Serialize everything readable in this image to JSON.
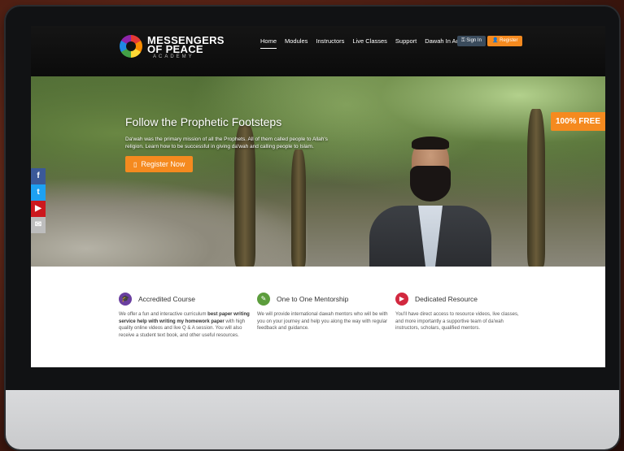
{
  "brand": {
    "line1": "MESSENGERS",
    "line2": "OF PEACE",
    "sub": "ACADEMY"
  },
  "nav": {
    "items": [
      "Home",
      "Modules",
      "Instructors",
      "Live Classes",
      "Support",
      "Dawah In Action"
    ],
    "signin": "Sign In",
    "register": "Register"
  },
  "hero": {
    "title": "Follow the Prophetic Footsteps",
    "text": "Da'wah was the primary mission of all the Prophets. All of them called people to Allah's religion. Learn how to be successful in giving da'wah and calling people to Islam.",
    "button": "Register Now",
    "badge": "100% FREE"
  },
  "social": [
    {
      "name": "facebook-icon",
      "glyph": "f",
      "color": "#3b5998"
    },
    {
      "name": "twitter-icon",
      "glyph": "t",
      "color": "#1da1f2"
    },
    {
      "name": "youtube-icon",
      "glyph": "▶",
      "color": "#cc181e"
    },
    {
      "name": "email-icon",
      "glyph": "✉",
      "color": "#bdbdbd"
    }
  ],
  "features": [
    {
      "title": "Accredited Course",
      "icon": "graduate-icon",
      "color": "#6a3fa0",
      "text_a": "We offer a fun and interactive curriculum ",
      "bold_a": "best paper writing service help with writing my homework paper",
      "text_b": " with high quality online videos and live Q & A session. You will also receive a student text book, and other useful resources."
    },
    {
      "title": "One to One Mentorship",
      "icon": "chat-icon",
      "color": "#5c9d3c",
      "text_a": "We will provide international dawah mentors who will be with you on your journey and help you along the way with regular feedback and guidance.",
      "bold_a": "",
      "text_b": ""
    },
    {
      "title": "Dedicated Resource",
      "icon": "play-icon",
      "color": "#d2283f",
      "text_a": "You'll have direct access to resource videos, live classes, and more importantly a supportive team of da'wah instructors, scholars, qualified mentors.",
      "bold_a": "",
      "text_b": ""
    }
  ]
}
